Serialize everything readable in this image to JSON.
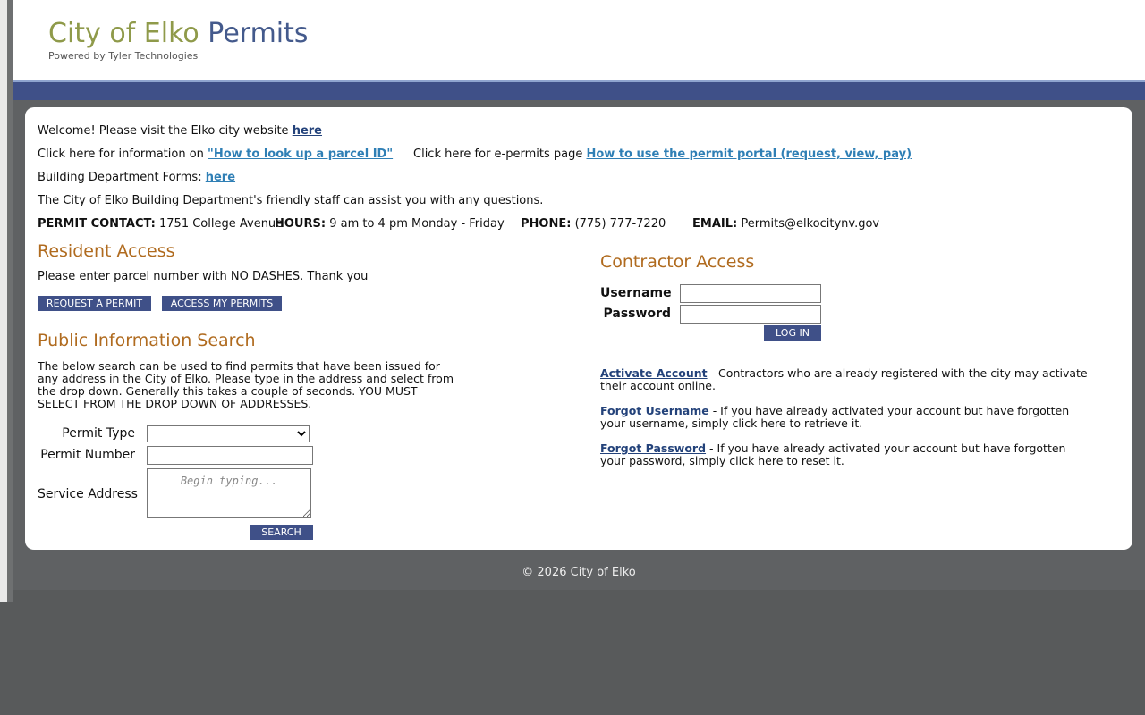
{
  "header": {
    "title_part1": "City of Elko",
    "title_part2": "Permits",
    "subtitle": "Powered by Tyler Technologies"
  },
  "intro": {
    "welcome_text": "Welcome! Please visit the Elko city website",
    "welcome_link": "here",
    "parcel_text": "Click here for information on",
    "parcel_link": "\"How to look up a parcel ID\"",
    "epermits_text": "Click here for e-permits page",
    "epermits_link": "How to use the permit portal (request, view, pay)",
    "forms_text": "Building Department Forms:",
    "forms_link": "here",
    "staff_text": "The City of Elko Building Department's friendly staff can assist you with any questions.",
    "contact_label": "PERMIT CONTACT:",
    "contact_value": "1751 College Avenue",
    "hours_label": "HOURS:",
    "hours_value": "9 am to 4 pm Monday - Friday",
    "phone_label": "PHONE:",
    "phone_value": "(775) 777-7220",
    "email_label": "EMAIL:",
    "email_value": "Permits@elkocitynv.gov"
  },
  "resident": {
    "heading": "Resident Access",
    "note": "Please enter parcel number with NO DASHES. Thank you",
    "request_button": "REQUEST A PERMIT",
    "access_button": "ACCESS MY PERMITS"
  },
  "search": {
    "heading": "Public Information Search",
    "description": "The below search can be used to find permits that have been issued for any address in the City of Elko. Please type in the address and select from the drop down. Generally this takes a couple of seconds. YOU MUST SELECT FROM THE DROP DOWN OF ADDRESSES.",
    "permit_type_label": "Permit Type",
    "permit_type_value": "",
    "permit_number_label": "Permit Number",
    "permit_number_value": "",
    "service_address_label": "Service Address",
    "service_address_placeholder": "Begin typing...",
    "search_button": "SEARCH"
  },
  "contractor": {
    "heading": "Contractor Access",
    "username_label": "Username",
    "username_value": "",
    "password_label": "Password",
    "password_value": "",
    "login_button": "LOG IN",
    "activate_link": "Activate Account",
    "activate_text": "- Contractors who are already registered with the city may activate their account online.",
    "forgot_username_link": "Forgot Username",
    "forgot_username_text": "- If you have already activated your account but have forgotten your username, simply click here to retrieve it.",
    "forgot_password_link": "Forgot Password",
    "forgot_password_text": "- If you have already activated your account but have forgotten your password, simply click here to reset it."
  },
  "footer": {
    "copyright": "© 2026 City of Elko"
  },
  "colors": {
    "brand_olive": "#8f9a4a",
    "brand_blue": "#445a8c",
    "heading_orange": "#b06b1f",
    "button_blue": "#3f5088"
  }
}
